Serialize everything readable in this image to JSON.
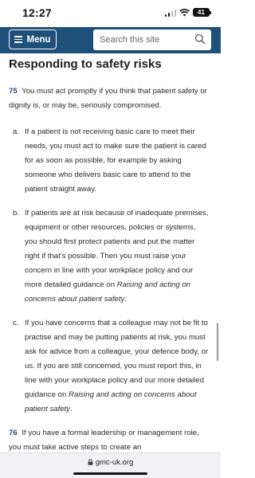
{
  "status_bar": {
    "time": "12:27",
    "battery": "41"
  },
  "header": {
    "menu_label": "Menu",
    "search_placeholder": "Search this site"
  },
  "page": {
    "heading": "Responding to safety risks",
    "p75": {
      "number": "75",
      "text": "You must act promptly if you think that patient safety or dignity is, or may be, seriously compromised."
    },
    "items": [
      {
        "letter": "a.",
        "text": "If a patient is not receiving basic care to meet their needs, you must act to make sure the patient is cared for as soon as possible, for example by asking someone who delivers basic care to attend to the patient straight away."
      },
      {
        "letter": "b.",
        "text": "If patients are at risk because of inadequate premises, equipment or other resources, policies or systems, you should first protect patients and put the matter right if that’s possible. Then you must raise your concern in line with your workplace policy and our more detailed guidance on ",
        "guidance": "Raising and acting on concerns about patient safety",
        "end": "."
      },
      {
        "letter": "c.",
        "text": "If you have concerns that a colleague may not be fit to practise and may be putting patients at risk, you must ask for advice from a colleague, your defence body, or us. If you are still concerned, you must report this, in line with your workplace policy and our more detailed guidance on ",
        "guidance": "Raising and acting on concerns about patient safety",
        "end": "."
      }
    ],
    "p76": {
      "number": "76",
      "text": "If you have a formal leadership or management role, you must take active steps to create an"
    }
  },
  "url_bar": {
    "domain": "gmc-uk.org"
  },
  "colors": {
    "header_bg": "#1f5079",
    "accent": "#1f5079",
    "url_bar_bg": "#f2f2f4"
  },
  "icons": [
    "signal-icon",
    "wifi-icon",
    "battery-icon",
    "hamburger-icon",
    "search-icon",
    "lock-icon"
  ]
}
